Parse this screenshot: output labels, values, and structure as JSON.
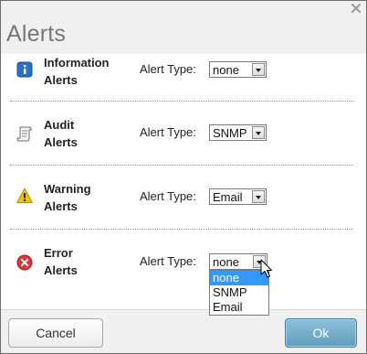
{
  "dialog": {
    "title": "Alerts",
    "close_icon": "close-icon"
  },
  "alert_type_label": "Alert Type:",
  "rows": [
    {
      "label_line1": "Information",
      "label_line2": "Alerts",
      "icon": "info-icon",
      "value": "none"
    },
    {
      "label_line1": "Audit",
      "label_line2": "Alerts",
      "icon": "scroll-icon",
      "value": "SNMP"
    },
    {
      "label_line1": "Warning",
      "label_line2": "Alerts",
      "icon": "warning-icon",
      "value": "Email"
    },
    {
      "label_line1": "Error",
      "label_line2": "Alerts",
      "icon": "error-icon",
      "value": "none"
    }
  ],
  "dropdown": {
    "options": [
      "none",
      "SNMP",
      "Email"
    ],
    "selected": "none"
  },
  "footer": {
    "cancel_label": "Cancel",
    "ok_label": "Ok"
  },
  "colors": {
    "accent": "#5e9dbd",
    "selected_option": "#3399ff",
    "info_icon": "#2a6fc9",
    "warning_icon": "#f2c200",
    "error_icon": "#d9363e"
  }
}
